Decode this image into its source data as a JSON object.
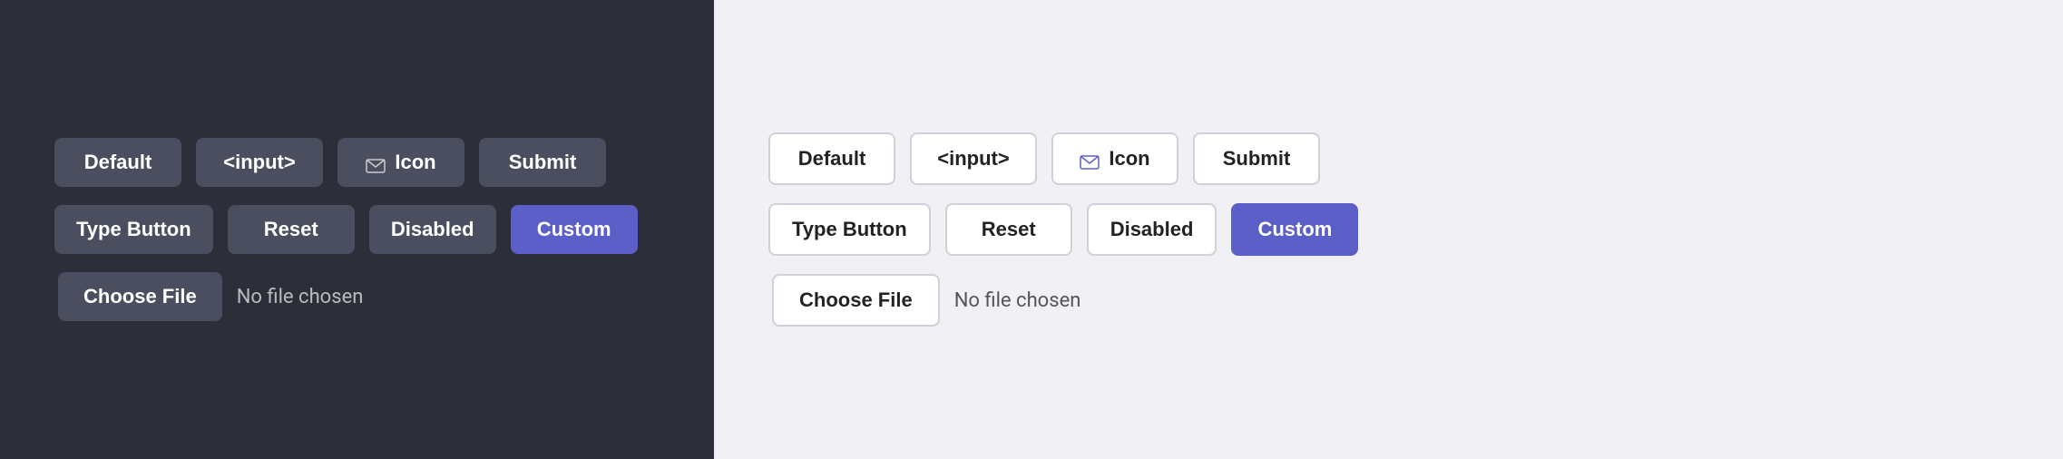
{
  "dark_panel": {
    "row1": {
      "btn1": {
        "label": "Default"
      },
      "btn2": {
        "label": "<input>"
      },
      "btn3_icon": {
        "label": "Icon"
      },
      "btn4": {
        "label": "Submit"
      }
    },
    "row2": {
      "btn1": {
        "label": "Type Button"
      },
      "btn2": {
        "label": "Reset"
      },
      "btn3": {
        "label": "Disabled"
      },
      "btn4": {
        "label": "Custom"
      }
    },
    "file_row": {
      "choose_label": "Choose File",
      "no_file_label": "No file chosen"
    }
  },
  "light_panel": {
    "row1": {
      "btn1": {
        "label": "Default"
      },
      "btn2": {
        "label": "<input>"
      },
      "btn3_icon": {
        "label": "Icon"
      },
      "btn4": {
        "label": "Submit"
      }
    },
    "row2": {
      "btn1": {
        "label": "Type Button"
      },
      "btn2": {
        "label": "Reset"
      },
      "btn3": {
        "label": "Disabled"
      },
      "btn4": {
        "label": "Custom"
      }
    },
    "file_row": {
      "choose_label": "Choose File",
      "no_file_label": "No file chosen"
    }
  }
}
